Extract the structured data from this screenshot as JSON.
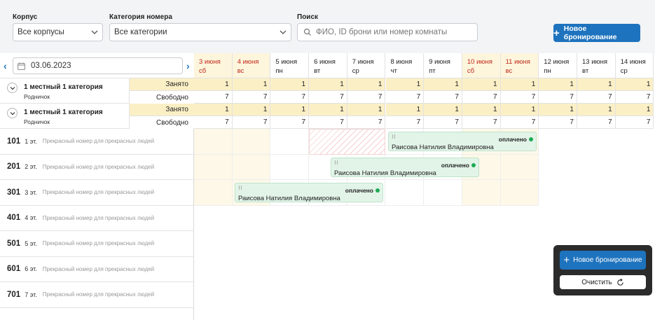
{
  "filters": {
    "building_label": "Корпус",
    "building_value": "Все корпусы",
    "category_label": "Категория номера",
    "category_value": "Все категории",
    "search_label": "Поиск",
    "search_placeholder": "ФИО, ID брони или номер комнаты",
    "new_booking": "Новое бронирование"
  },
  "datebar": {
    "date": "03.06.2023"
  },
  "days": [
    {
      "num": "3 июня",
      "dow": "сб",
      "weekend": true
    },
    {
      "num": "4 июня",
      "dow": "вс",
      "weekend": true
    },
    {
      "num": "5 июня",
      "dow": "пн",
      "weekend": false
    },
    {
      "num": "6 июня",
      "dow": "вт",
      "weekend": false
    },
    {
      "num": "7 июня",
      "dow": "ср",
      "weekend": false
    },
    {
      "num": "8 июня",
      "dow": "чт",
      "weekend": false
    },
    {
      "num": "9 июня",
      "dow": "пт",
      "weekend": false
    },
    {
      "num": "10 июня",
      "dow": "сб",
      "weekend": true
    },
    {
      "num": "11 июня",
      "dow": "вс",
      "weekend": true
    },
    {
      "num": "12 июня",
      "dow": "пн",
      "weekend": false
    },
    {
      "num": "13 июня",
      "dow": "вт",
      "weekend": false
    },
    {
      "num": "14 июня",
      "dow": "ср",
      "weekend": false
    }
  ],
  "categories": [
    {
      "name": "1 местный 1 категория",
      "sub": "Родничок",
      "busy_label": "Занято",
      "free_label": "Свободно",
      "busy": [
        "1",
        "1",
        "1",
        "1",
        "1",
        "1",
        "1",
        "1",
        "1",
        "1",
        "1",
        "1"
      ],
      "free": [
        "7",
        "7",
        "7",
        "7",
        "7",
        "7",
        "7",
        "7",
        "7",
        "7",
        "7",
        "7"
      ]
    },
    {
      "name": "1 местный 1 категория",
      "sub": "Родничок",
      "busy_label": "Занято",
      "free_label": "Свободно",
      "busy": [
        "1",
        "1",
        "1",
        "1",
        "1",
        "1",
        "1",
        "1",
        "1",
        "1",
        "1",
        "1"
      ],
      "free": [
        "7",
        "7",
        "7",
        "7",
        "7",
        "7",
        "7",
        "7",
        "7",
        "7",
        "7",
        "7"
      ]
    }
  ],
  "rooms": [
    {
      "num": "101",
      "floor": "1 эт.",
      "desc": "Прекрасный номер для прекрасных людей"
    },
    {
      "num": "201",
      "floor": "2 эт.",
      "desc": "Прекрасный номер для прекрасных людей"
    },
    {
      "num": "301",
      "floor": "3 эт.",
      "desc": "Прекрасный номер для прекрасных людей"
    },
    {
      "num": "401",
      "floor": "4 эт.",
      "desc": "Прекрасный номер для прекрасных людей"
    },
    {
      "num": "501",
      "floor": "5 эт.",
      "desc": "Прекрасный номер для прекрасных людей"
    },
    {
      "num": "601",
      "floor": "6 эт.",
      "desc": "Прекрасный номер для прекрасных людей"
    },
    {
      "num": "701",
      "floor": "7 эт.",
      "desc": "Прекрасный номер для прекрасных людей"
    }
  ],
  "bookings": [
    {
      "room": "101",
      "guest": "Раисова Натилия Владимировна",
      "status": "оплачено"
    },
    {
      "room": "201",
      "guest": "Раисова Натилия Владимировна",
      "status": "оплачено"
    },
    {
      "room": "301",
      "guest": "Раисова Натилия Владимировна",
      "status": "оплачено"
    }
  ],
  "floating": {
    "new_booking": "Новое бронирование",
    "clear": "Очистить"
  },
  "icons": {
    "calendar": "calendar-icon",
    "chevron": "chevron-down-icon",
    "search": "search-icon",
    "refresh": "refresh-icon",
    "plus": "plus-icon",
    "drag": "drag-handle-icon"
  },
  "colors": {
    "accent": "#1e73be",
    "weekend": "#c0281b",
    "busy_row": "#fbefc6",
    "booking": "#e2f4e8",
    "paid_dot": "#1fa955"
  }
}
